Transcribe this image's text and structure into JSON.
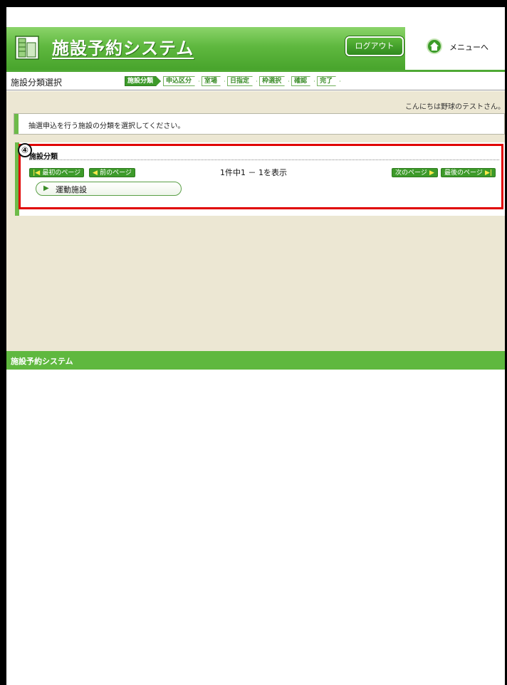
{
  "header": {
    "app_title": "施設予約システム",
    "logout_label": "ログアウト",
    "menu_label": "メニューへ"
  },
  "stepbar": {
    "screen_title": "施設分類選択",
    "steps": [
      "施設分類",
      "申込区分",
      "室場",
      "日指定",
      "枠選択",
      "確認",
      "完了"
    ],
    "active_step": "施設分類"
  },
  "main": {
    "greeting": "こんにちは野球のテストさん。",
    "instruction": "抽選申込を行う施設の分類を選択してください。",
    "panel": {
      "title": "施設分類",
      "first_page": "最初のページ",
      "prev_page": "前のページ",
      "count_text": "1件中1 － 1を表示",
      "next_page": "次のページ",
      "last_page": "最後のページ",
      "category": "運動施設"
    },
    "step_marker": "④",
    "highlight_color": "#e00000"
  },
  "footer": {
    "text": "施設予約システム"
  },
  "colors": {
    "brand_green": "#5fb83f",
    "background_beige": "#ece7d3"
  }
}
